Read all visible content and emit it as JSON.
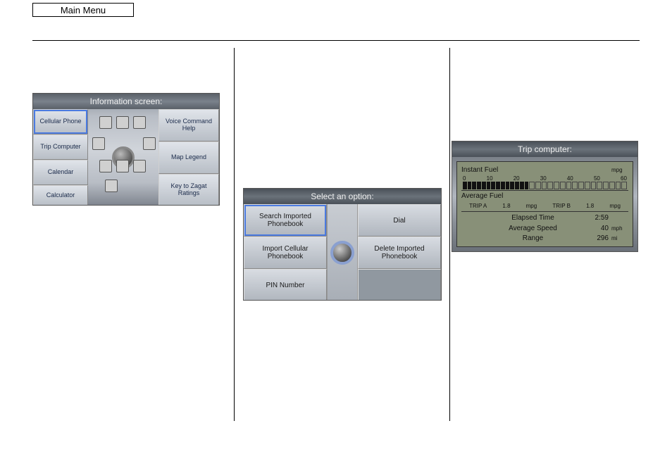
{
  "main_menu_label": "Main Menu",
  "info_screen": {
    "title": "Information screen:",
    "left_buttons": [
      "Cellular Phone",
      "Trip Computer",
      "Calendar",
      "Calculator"
    ],
    "right_buttons": [
      "Voice Command Help",
      "Map Legend",
      "Key to Zagat Ratings"
    ],
    "selected": "Cellular Phone"
  },
  "select_option": {
    "title": "Select an option:",
    "left_buttons": [
      "Search Imported Phonebook",
      "Import Cellular Phonebook",
      "PIN Number"
    ],
    "right_buttons": [
      "Dial",
      "Delete Imported Phonebook",
      ""
    ],
    "selected": "Search Imported Phonebook"
  },
  "trip_computer": {
    "title": "Trip computer:",
    "instant_fuel_label": "Instant Fuel",
    "instant_fuel_unit": "mpg",
    "scale": [
      "0",
      "10",
      "20",
      "30",
      "40",
      "50",
      "60"
    ],
    "filled_bars": 14,
    "total_bars": 30,
    "average_fuel_label": "Average Fuel",
    "trip_a_label": "TRIP A",
    "trip_a_value": "1.8",
    "trip_a_unit": "mpg",
    "trip_b_label": "TRIP B",
    "trip_b_value": "1.8",
    "trip_b_unit": "mpg",
    "rows": [
      {
        "label": "Elapsed Time",
        "value": "2:59",
        "unit": ""
      },
      {
        "label": "Average Speed",
        "value": "40",
        "unit": "mph"
      },
      {
        "label": "Range",
        "value": "296",
        "unit": "mi"
      }
    ]
  }
}
